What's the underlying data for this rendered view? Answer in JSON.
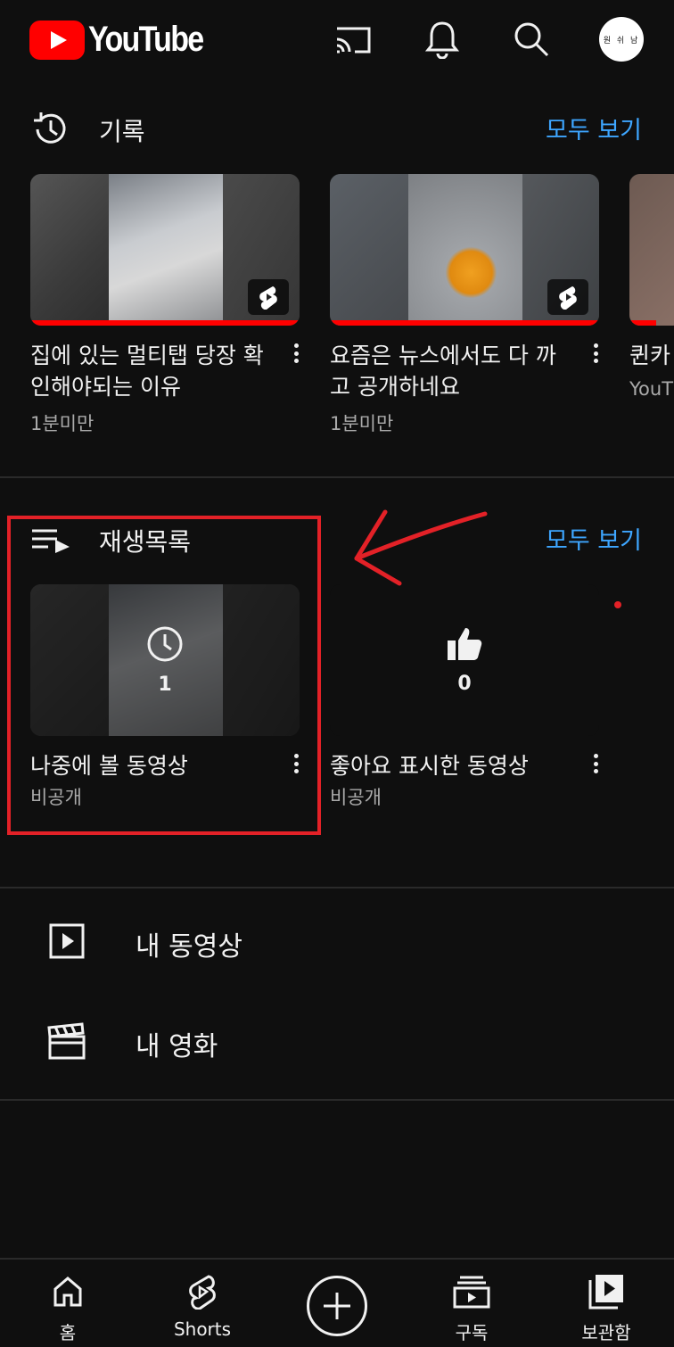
{
  "header": {
    "logo_text": "YouTube",
    "avatar_text": "원 쉬 남",
    "icons": [
      "cast-icon",
      "notifications-icon",
      "search-icon"
    ]
  },
  "history": {
    "title": "기록",
    "see_all": "모두 보기",
    "items": [
      {
        "title": "집에 있는 멀티탭 당장 확인해야되는 이유",
        "meta": "1분미만",
        "is_short": true
      },
      {
        "title": "요즘은 뉴스에서도 다 까고 공개하네요",
        "meta": "1분미만",
        "is_short": true
      },
      {
        "title": "퀸카 많았",
        "meta": "YouT"
      }
    ]
  },
  "playlists": {
    "title": "재생목록",
    "see_all": "모두 보기",
    "items": [
      {
        "title": "나중에 볼 동영상",
        "meta": "비공개",
        "count": "1",
        "icon": "clock-icon"
      },
      {
        "title": "좋아요 표시한 동영상",
        "meta": "비공개",
        "count": "0",
        "icon": "thumbs-up-icon"
      }
    ]
  },
  "library_rows": [
    {
      "label": "내 동영상",
      "icon": "my-videos-icon"
    },
    {
      "label": "내 영화",
      "icon": "movies-clapper-icon"
    }
  ],
  "bottom_nav": {
    "home": "홈",
    "shorts": "Shorts",
    "subscriptions": "구독",
    "library": "보관함"
  },
  "colors": {
    "background": "#0f0f0f",
    "accent_link": "#3ea6ff",
    "brand_red": "#ff0000",
    "annotation_red": "#e32127"
  }
}
